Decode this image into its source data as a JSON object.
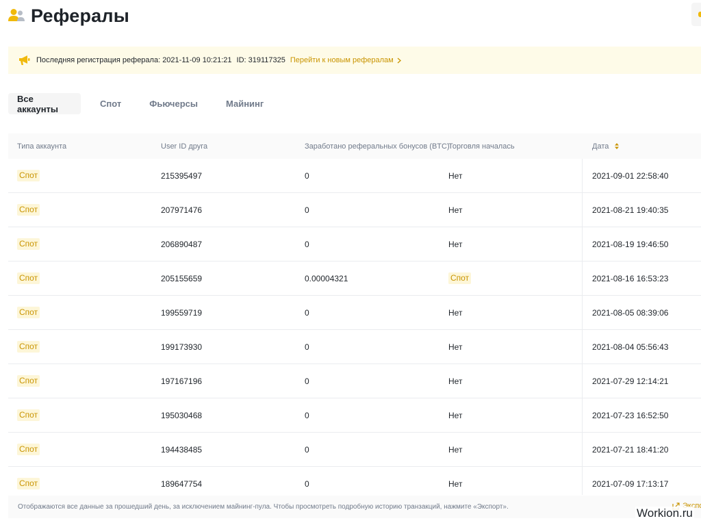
{
  "header": {
    "title": "Рефералы",
    "icon": "users-icon",
    "accent_color": "#f0b90b"
  },
  "notice": {
    "registration_text": "Последняя регистрация реферала: 2021-11-09 10:21:21",
    "id_text": "ID: 319117325",
    "link_label": "Перейти к новым рефералам"
  },
  "tabs": [
    "Все аккаунты",
    "Спот",
    "Фьючерсы",
    "Майнинг"
  ],
  "table": {
    "headers": [
      "Типа аккаунта",
      "User ID друга",
      "Заработано реферальных бонусов (BTC)",
      "Торговля началась",
      "Дата"
    ],
    "rows": [
      {
        "type": "Спот",
        "user_id": "215395497",
        "earned": "0",
        "trading": "Нет",
        "date": "2021-09-01 22:58:40"
      },
      {
        "type": "Спот",
        "user_id": "207971476",
        "earned": "0",
        "trading": "Нет",
        "date": "2021-08-21 19:40:35"
      },
      {
        "type": "Спот",
        "user_id": "206890487",
        "earned": "0",
        "trading": "Нет",
        "date": "2021-08-19 19:46:50"
      },
      {
        "type": "Спот",
        "user_id": "205155659",
        "earned": "0.00004321",
        "trading": "Спот",
        "date": "2021-08-16 16:53:23"
      },
      {
        "type": "Спот",
        "user_id": "199559719",
        "earned": "0",
        "trading": "Нет",
        "date": "2021-08-05 08:39:06"
      },
      {
        "type": "Спот",
        "user_id": "199173930",
        "earned": "0",
        "trading": "Нет",
        "date": "2021-08-04 05:56:43"
      },
      {
        "type": "Спот",
        "user_id": "197167196",
        "earned": "0",
        "trading": "Нет",
        "date": "2021-07-29 12:14:21"
      },
      {
        "type": "Спот",
        "user_id": "195030468",
        "earned": "0",
        "trading": "Нет",
        "date": "2021-07-23 16:52:50"
      },
      {
        "type": "Спот",
        "user_id": "194438485",
        "earned": "0",
        "trading": "Нет",
        "date": "2021-07-21 18:41:20"
      },
      {
        "type": "Спот",
        "user_id": "189647754",
        "earned": "0",
        "trading": "Нет",
        "date": "2021-07-09 17:13:17"
      }
    ]
  },
  "footer": {
    "text": "Отображаются все данные за прошедший день, за исключением майнинг-пула. Чтобы просмотреть подробную историю транзакций, нажмите «Экспорт».",
    "export_label": "Экспо"
  },
  "watermark": "Workion.ru"
}
